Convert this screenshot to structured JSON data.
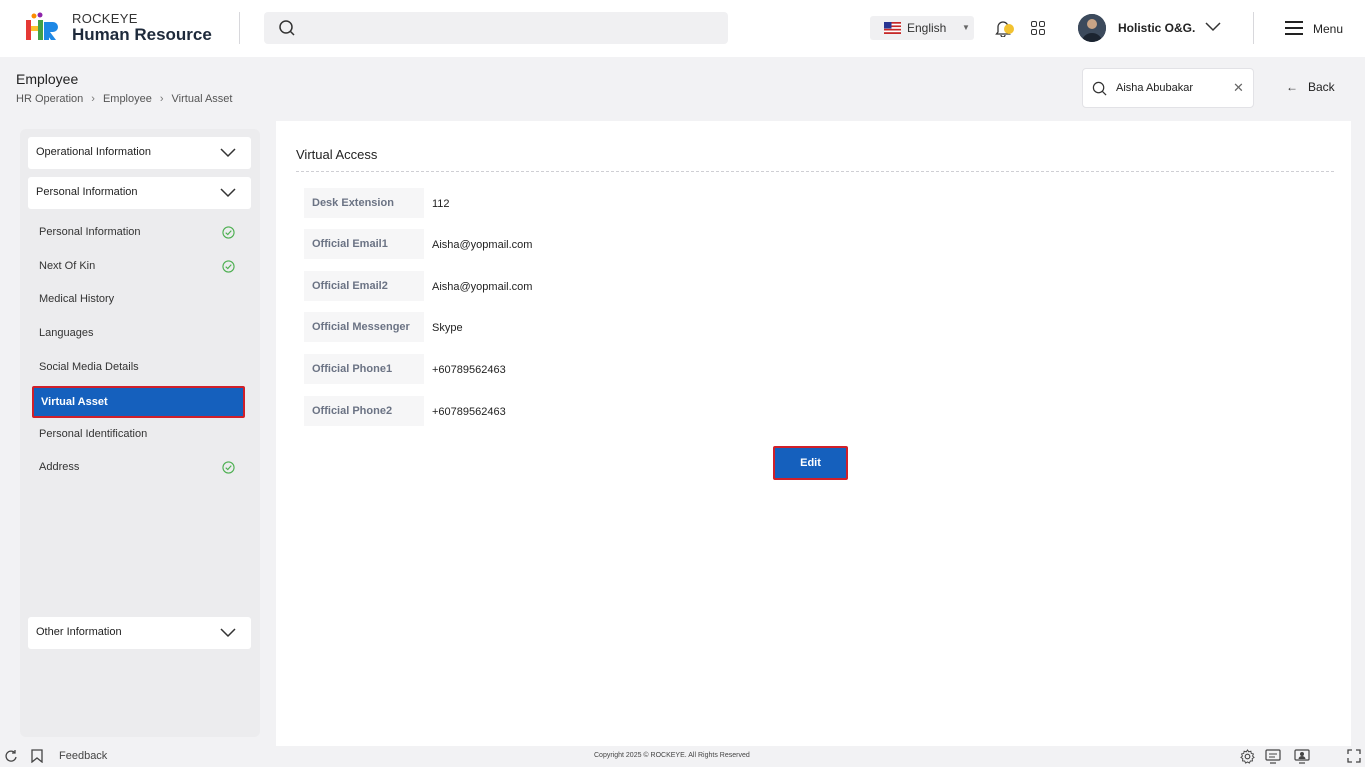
{
  "app": {
    "brand_sub": "ROCKEYE",
    "brand_title": "Human Resource",
    "language": "English",
    "notification_count": "0",
    "user_name": "Holistic O&G.",
    "menu_label": "Menu"
  },
  "page": {
    "title": "Employee",
    "breadcrumb": [
      "HR Operation",
      "Employee",
      "Virtual Asset"
    ],
    "employee_search_value": "Aisha Abubakar",
    "back_label": "Back"
  },
  "sidebar": {
    "sections": {
      "operational": "Operational Information",
      "personal": "Personal Information",
      "other": "Other Information"
    },
    "items": [
      {
        "label": "Personal Information",
        "done": true
      },
      {
        "label": "Next Of Kin",
        "done": true
      },
      {
        "label": "Medical History",
        "done": false
      },
      {
        "label": "Languages",
        "done": false
      },
      {
        "label": "Social Media Details",
        "done": false
      },
      {
        "label": "Virtual Asset",
        "done": false,
        "active": true
      },
      {
        "label": "Personal Identification",
        "done": false
      },
      {
        "label": "Address",
        "done": true
      }
    ]
  },
  "main": {
    "section_title": "Virtual Access",
    "fields": [
      {
        "label": "Desk Extension",
        "value": "112"
      },
      {
        "label": "Official Email1",
        "value": "Aisha@yopmail.com"
      },
      {
        "label": "Official Email2",
        "value": "Aisha@yopmail.com"
      },
      {
        "label": "Official Messenger",
        "value": "Skype"
      },
      {
        "label": "Official Phone1",
        "value": "+60789562463"
      },
      {
        "label": "Official Phone2",
        "value": "+60789562463"
      }
    ],
    "edit_label": "Edit"
  },
  "footer": {
    "feedback": "Feedback",
    "copyright": "Copyright 2025 © ROCKEYE. All Rights Reserved"
  },
  "colors": {
    "primary": "#1560bd",
    "highlight_border": "#d0202a",
    "check": "#4caf50"
  }
}
